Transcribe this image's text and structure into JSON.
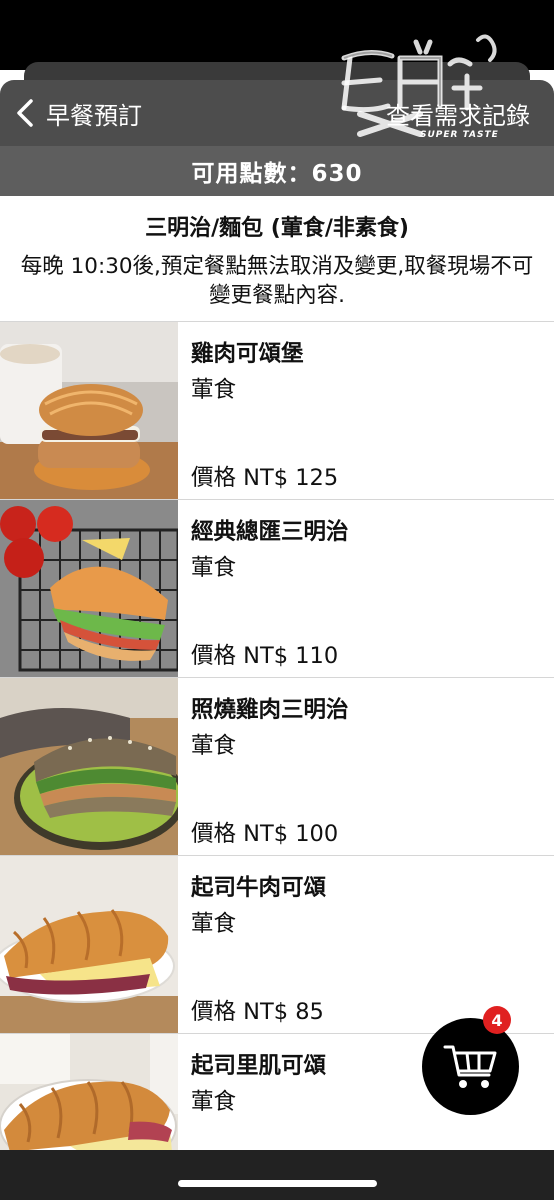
{
  "header": {
    "back_label": "早餐預訂",
    "history_label": "查看需求記錄"
  },
  "watermark": {
    "text": "SUPER TASTE"
  },
  "points": {
    "text": "可用點數：630"
  },
  "category": {
    "title": "三明治/麵包 (葷食/非素食)",
    "note": "每晚 10:30後,預定餐點無法取消及變更,取餐現場不可變更餐點內容."
  },
  "items": [
    {
      "name": "雞肉可頌堡",
      "type": "葷食",
      "price": "價格 NT$ 125",
      "image": "chicken-croissant-burger"
    },
    {
      "name": "經典總匯三明治",
      "type": "葷食",
      "price": "價格 NT$ 110",
      "image": "club-sandwich"
    },
    {
      "name": "照燒雞肉三明治",
      "type": "葷食",
      "price": "價格 NT$ 100",
      "image": "teriyaki-chicken-sandwich"
    },
    {
      "name": "起司牛肉可頌",
      "type": "葷食",
      "price": "價格 NT$ 85",
      "image": "cheese-beef-croissant"
    },
    {
      "name": "起司里肌可頌",
      "type": "葷食",
      "price": "",
      "image": "cheese-pork-croissant"
    }
  ],
  "cart": {
    "badge_count": "4",
    "icon": "cart-icon"
  },
  "colors": {
    "header_bg": "#4d4d4d",
    "points_bg": "#5e5e5e",
    "badge": "#e02020",
    "cart_bg": "#000000"
  }
}
